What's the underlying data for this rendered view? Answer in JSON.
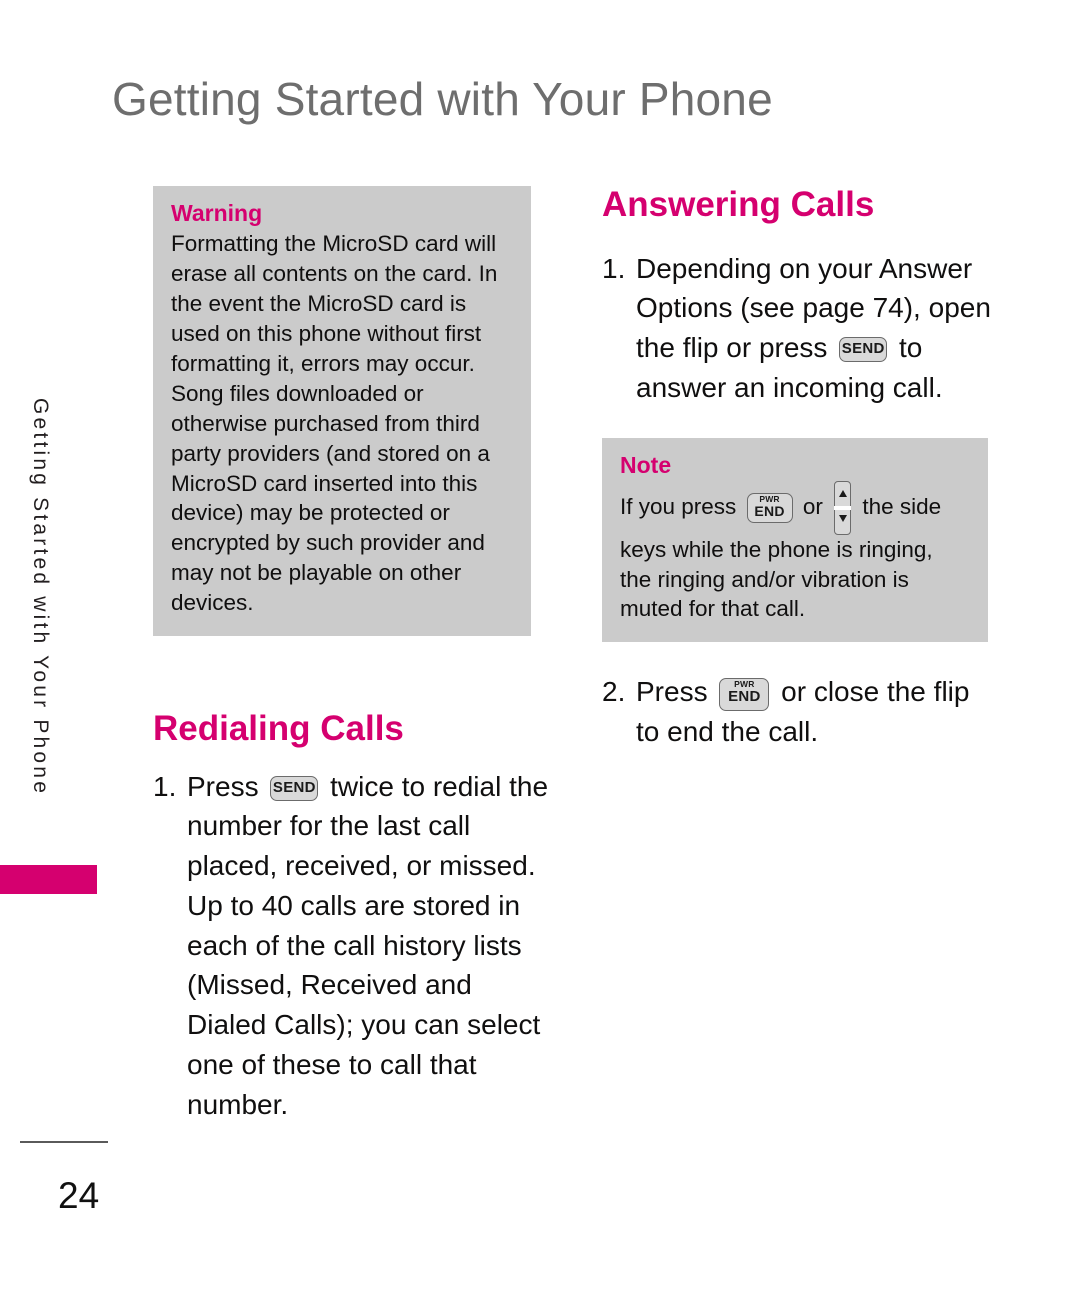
{
  "page": {
    "title": "Getting Started with Your Phone",
    "number": "24"
  },
  "sidebar": {
    "label": "Getting Started with Your Phone",
    "tab_color": "#d5006f"
  },
  "colors": {
    "accent": "#d5006f",
    "callout_background": "#cbcbcb",
    "title_gray": "#6e6e6e",
    "body_text": "#100f0f"
  },
  "left_column": {
    "warning": {
      "title": "Warning",
      "body": "Formatting the MicroSD card will erase all contents on the card. In the event the MicroSD card is used on this phone without first formatting it, errors may occur. Song files downloaded or otherwise purchased from third party providers (and stored on a MicroSD card inserted into this device) may be protected or encrypted by such provider and may not be playable on other devices."
    },
    "redialing": {
      "heading": "Redialing Calls",
      "steps": [
        {
          "number": "1.",
          "text_before": "Press",
          "key": "SEND",
          "text_after": "twice to redial the number for the last call placed, received, or missed. Up to 40 calls are stored in each of the call history lists (Missed, Received and Dialed Calls); you can select one of these to call that number."
        }
      ]
    }
  },
  "right_column": {
    "answering": {
      "heading": "Answering Calls",
      "step1": {
        "number": "1.",
        "text_before": "Depending on your Answer Options (see page 74), open the flip or press",
        "key": "SEND",
        "text_after": "to answer an incoming call."
      },
      "step2": {
        "number": "2.",
        "text_before": "Press",
        "key_pwr": "PWR",
        "key_end": "END",
        "text_after": "or close the flip to end the call."
      }
    },
    "note": {
      "title": "Note",
      "text_before": "If you press",
      "key_pwr": "PWR",
      "key_end": "END",
      "text_middle": "or",
      "text_after": "the side keys while the phone is ringing, the ringing and/or vibration is muted for that call."
    }
  },
  "keys": {
    "send_label": "SEND",
    "pwr_label": "PWR",
    "end_label": "END"
  }
}
